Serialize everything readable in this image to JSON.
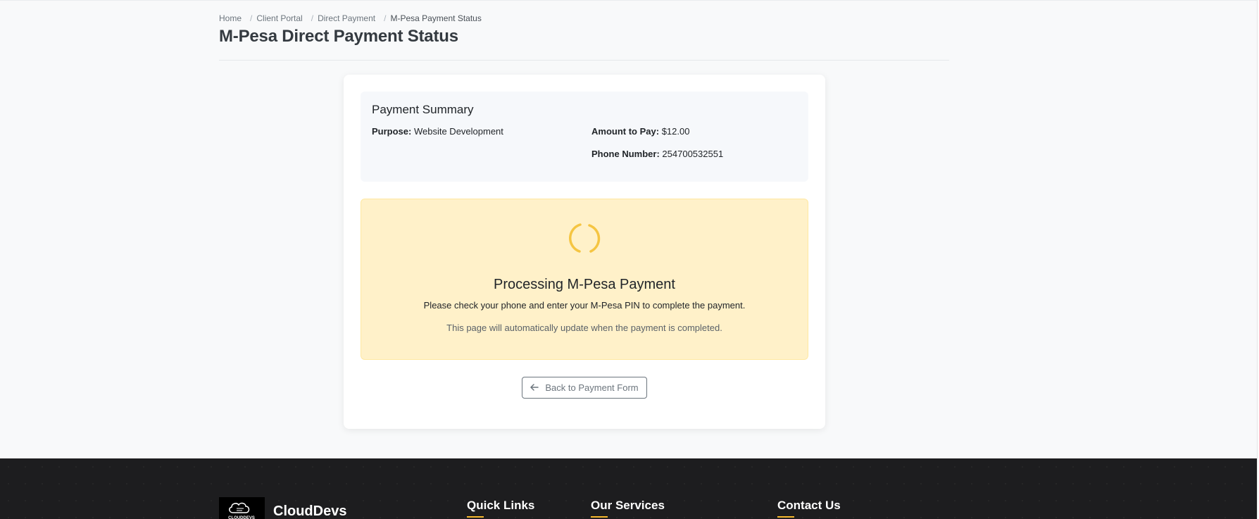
{
  "breadcrumb": {
    "items": [
      "Home",
      "Client Portal",
      "Direct Payment"
    ],
    "current": "M-Pesa Payment Status"
  },
  "page": {
    "title": "M-Pesa Direct Payment Status"
  },
  "summary": {
    "title": "Payment Summary",
    "purpose_label": "Purpose:",
    "purpose_value": "Website Development",
    "amount_label": "Amount to Pay:",
    "amount_value": "$12.00",
    "phone_label": "Phone Number:",
    "phone_value": "254700532551"
  },
  "status": {
    "title": "Processing M-Pesa Payment",
    "message": "Please check your phone and enter your M-Pesa PIN to complete the payment.",
    "note": "This page will automatically update when the payment is completed.",
    "spinner_color": "#f5c542"
  },
  "actions": {
    "back_label": "Back to Payment Form",
    "back_icon": "arrow-left-icon"
  },
  "footer": {
    "brand": "CloudDevs",
    "logo_text": "CLOUDDEVS",
    "headings": [
      "Quick Links",
      "Our Services",
      "Contact Us"
    ],
    "accent": "#f5b82e"
  }
}
